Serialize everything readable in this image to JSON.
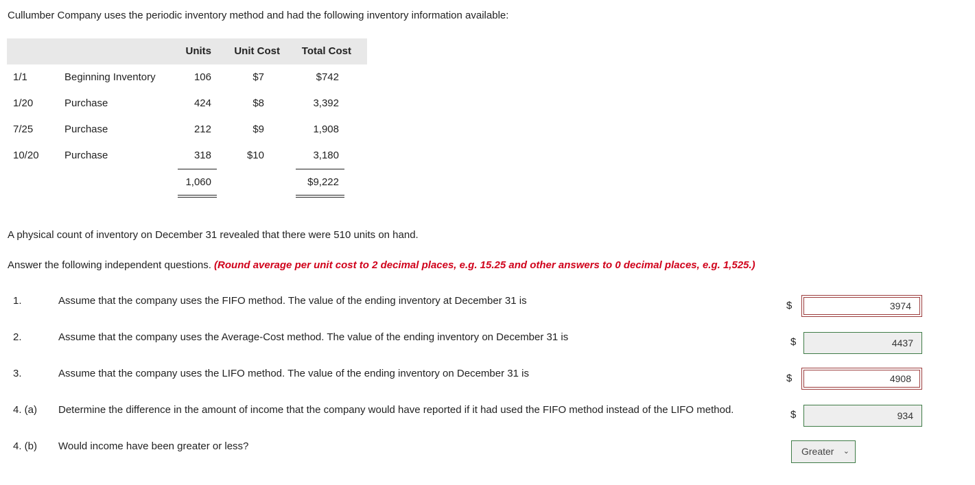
{
  "intro": "Cullumber Company uses the periodic inventory method and had the following inventory information available:",
  "table": {
    "headers": [
      "Units",
      "Unit Cost",
      "Total Cost"
    ],
    "rows": [
      {
        "date": "1/1",
        "desc": "Beginning Inventory",
        "units": "106",
        "unit_cost": "$7",
        "total": "$742"
      },
      {
        "date": "1/20",
        "desc": "Purchase",
        "units": "424",
        "unit_cost": "$8",
        "total": "3,392"
      },
      {
        "date": "7/25",
        "desc": "Purchase",
        "units": "212",
        "unit_cost": "$9",
        "total": "1,908"
      },
      {
        "date": "10/20",
        "desc": "Purchase",
        "units": "318",
        "unit_cost": "$10",
        "total": "3,180"
      }
    ],
    "totals": {
      "units": "1,060",
      "total": "$9,222"
    }
  },
  "count_text": "A physical count of inventory on December 31 revealed that there were 510 units on hand.",
  "instructions": "Answer the following independent questions.",
  "hint": "(Round average per unit cost to 2 decimal places, e.g. 15.25 and other answers to 0 decimal places, e.g. 1,525.)",
  "questions": [
    {
      "num": "1.",
      "text": "Assume that the company uses the FIFO method. The value of the ending inventory at December 31 is",
      "currency": "$",
      "answer": "3974",
      "status": "incorrect"
    },
    {
      "num": "2.",
      "text": "Assume that the company uses the Average-Cost method. The value of the ending inventory on December 31 is",
      "currency": "$",
      "answer": "4437",
      "status": "correct"
    },
    {
      "num": "3.",
      "text": "Assume that the company uses the LIFO method. The value of the ending inventory on December 31 is",
      "currency": "$",
      "answer": "4908",
      "status": "incorrect"
    },
    {
      "num": "4. (a)",
      "text": "Determine the difference in the amount of income that the company would have reported if it had used the FIFO method instead of the LIFO method.",
      "currency": "$",
      "answer": "934",
      "status": "correct"
    },
    {
      "num": "4. (b)",
      "text": "Would income have been greater or less?",
      "select": "Greater",
      "status": "correct"
    }
  ],
  "colors": {
    "incorrect": "#9b3b3b",
    "correct": "#3e7b46",
    "hint": "#d0021b"
  }
}
